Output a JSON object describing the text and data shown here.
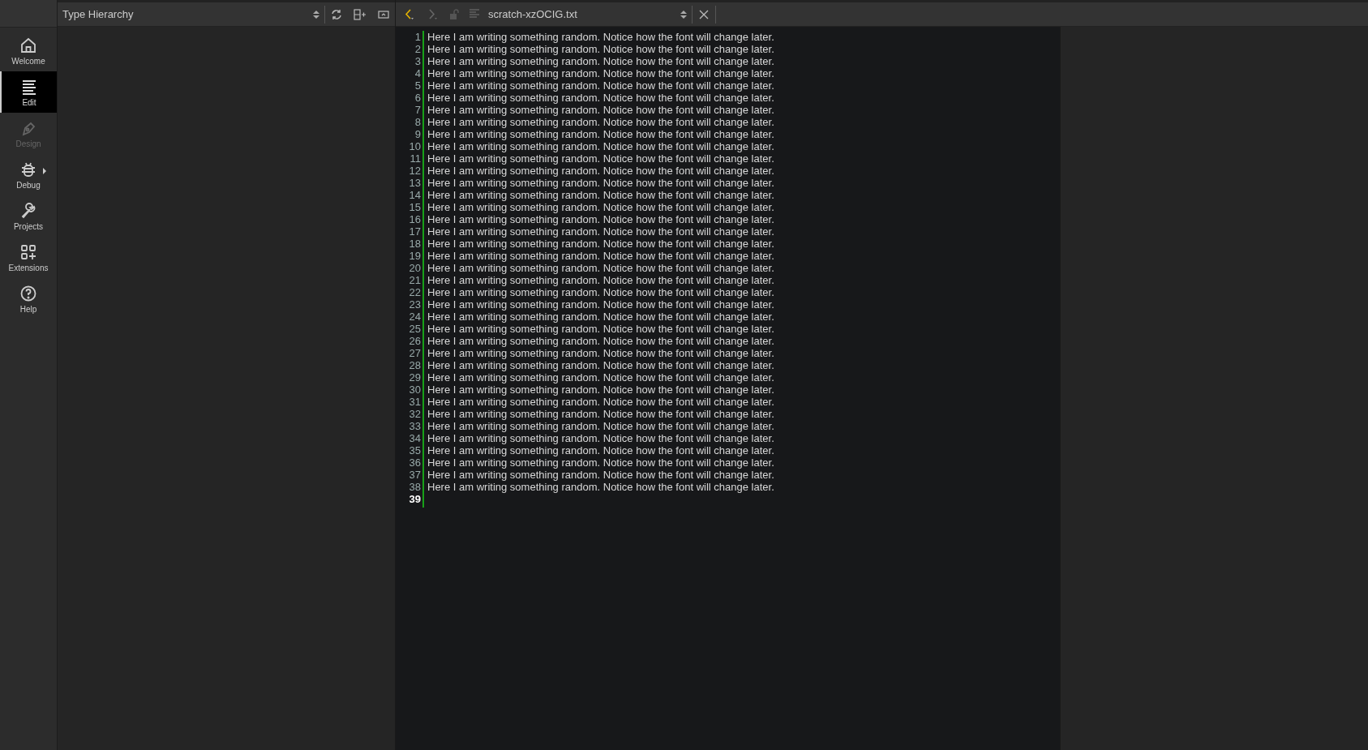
{
  "sidebar": {
    "items": [
      {
        "label": "Welcome",
        "kind": "home",
        "selected": false,
        "disabled": false,
        "has_menu": false
      },
      {
        "label": "Edit",
        "kind": "edit",
        "selected": true,
        "disabled": false,
        "has_menu": false
      },
      {
        "label": "Design",
        "kind": "design",
        "selected": false,
        "disabled": true,
        "has_menu": false
      },
      {
        "label": "Debug",
        "kind": "debug",
        "selected": false,
        "disabled": false,
        "has_menu": true
      },
      {
        "label": "Projects",
        "kind": "projects",
        "selected": false,
        "disabled": false,
        "has_menu": false
      },
      {
        "label": "Extensions",
        "kind": "extensions",
        "selected": false,
        "disabled": false,
        "has_menu": false
      },
      {
        "label": "Help",
        "kind": "help",
        "selected": false,
        "disabled": false,
        "has_menu": false
      }
    ]
  },
  "panel": {
    "view": "Type Hierarchy"
  },
  "editor": {
    "file": "scratch-xzOCIG.txt",
    "lines": [
      {
        "number": "1",
        "text": "Here I am writing something random. Notice how the font will change later.",
        "current": false
      },
      {
        "number": "2",
        "text": "Here I am writing something random. Notice how the font will change later.",
        "current": false
      },
      {
        "number": "3",
        "text": "Here I am writing something random. Notice how the font will change later.",
        "current": false
      },
      {
        "number": "4",
        "text": "Here I am writing something random. Notice how the font will change later.",
        "current": false
      },
      {
        "number": "5",
        "text": "Here I am writing something random. Notice how the font will change later.",
        "current": false
      },
      {
        "number": "6",
        "text": "Here I am writing something random. Notice how the font will change later.",
        "current": false
      },
      {
        "number": "7",
        "text": "Here I am writing something random. Notice how the font will change later.",
        "current": false
      },
      {
        "number": "8",
        "text": "Here I am writing something random. Notice how the font will change later.",
        "current": false
      },
      {
        "number": "9",
        "text": "Here I am writing something random. Notice how the font will change later.",
        "current": false
      },
      {
        "number": "10",
        "text": "Here I am writing something random. Notice how the font will change later.",
        "current": false
      },
      {
        "number": "11",
        "text": "Here I am writing something random. Notice how the font will change later.",
        "current": false
      },
      {
        "number": "12",
        "text": "Here I am writing something random. Notice how the font will change later.",
        "current": false
      },
      {
        "number": "13",
        "text": "Here I am writing something random. Notice how the font will change later.",
        "current": false
      },
      {
        "number": "14",
        "text": "Here I am writing something random. Notice how the font will change later.",
        "current": false
      },
      {
        "number": "15",
        "text": "Here I am writing something random. Notice how the font will change later.",
        "current": false
      },
      {
        "number": "16",
        "text": "Here I am writing something random. Notice how the font will change later.",
        "current": false
      },
      {
        "number": "17",
        "text": "Here I am writing something random. Notice how the font will change later.",
        "current": false
      },
      {
        "number": "18",
        "text": "Here I am writing something random. Notice how the font will change later.",
        "current": false
      },
      {
        "number": "19",
        "text": "Here I am writing something random. Notice how the font will change later.",
        "current": false
      },
      {
        "number": "20",
        "text": "Here I am writing something random. Notice how the font will change later.",
        "current": false
      },
      {
        "number": "21",
        "text": "Here I am writing something random. Notice how the font will change later.",
        "current": false
      },
      {
        "number": "22",
        "text": "Here I am writing something random. Notice how the font will change later.",
        "current": false
      },
      {
        "number": "23",
        "text": "Here I am writing something random. Notice how the font will change later.",
        "current": false
      },
      {
        "number": "24",
        "text": "Here I am writing something random. Notice how the font will change later.",
        "current": false
      },
      {
        "number": "25",
        "text": "Here I am writing something random. Notice how the font will change later.",
        "current": false
      },
      {
        "number": "26",
        "text": "Here I am writing something random. Notice how the font will change later.",
        "current": false
      },
      {
        "number": "27",
        "text": "Here I am writing something random. Notice how the font will change later.",
        "current": false
      },
      {
        "number": "28",
        "text": "Here I am writing something random. Notice how the font will change later.",
        "current": false
      },
      {
        "number": "29",
        "text": "Here I am writing something random. Notice how the font will change later.",
        "current": false
      },
      {
        "number": "30",
        "text": "Here I am writing something random. Notice how the font will change later.",
        "current": false
      },
      {
        "number": "31",
        "text": "Here I am writing something random. Notice how the font will change later.",
        "current": false
      },
      {
        "number": "32",
        "text": "Here I am writing something random. Notice how the font will change later.",
        "current": false
      },
      {
        "number": "33",
        "text": "Here I am writing something random. Notice how the font will change later.",
        "current": false
      },
      {
        "number": "34",
        "text": "Here I am writing something random. Notice how the font will change later.",
        "current": false
      },
      {
        "number": "35",
        "text": "Here I am writing something random. Notice how the font will change later.",
        "current": false
      },
      {
        "number": "36",
        "text": "Here I am writing something random. Notice how the font will change later.",
        "current": false
      },
      {
        "number": "37",
        "text": "Here I am writing something random. Notice how the font will change later.",
        "current": false
      },
      {
        "number": "38",
        "text": "Here I am writing something random. Notice how the font will change later.",
        "current": false
      },
      {
        "number": "39",
        "current": true
      }
    ]
  }
}
